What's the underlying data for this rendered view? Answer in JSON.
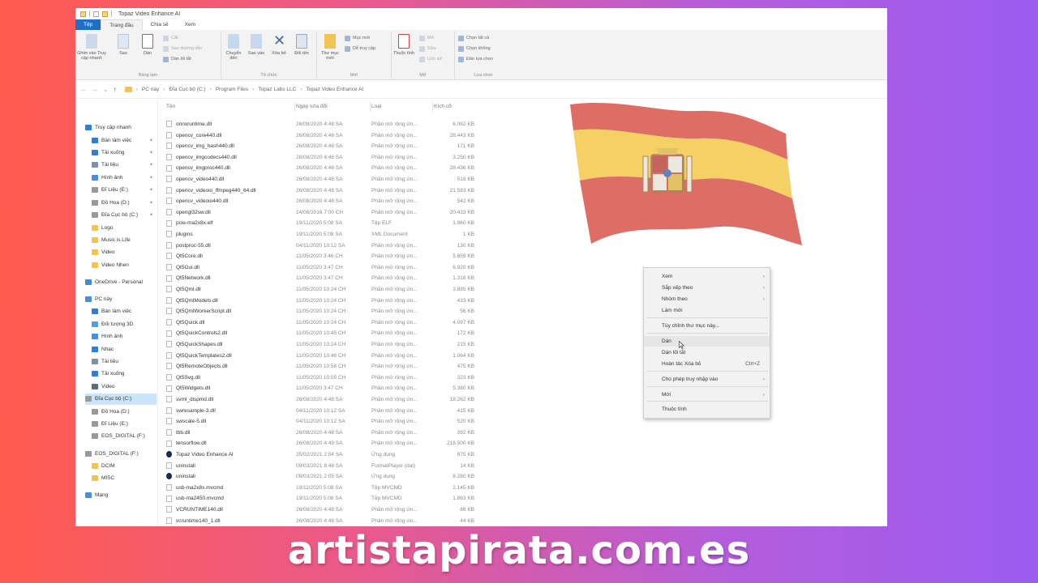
{
  "window": {
    "title": "Topaz Video Enhance AI",
    "tabs": [
      "Tệp",
      "Trang đầu",
      "Chia sẻ",
      "Xem"
    ]
  },
  "ribbon": {
    "clipboard": {
      "pin": "Ghim vào Truy cập nhanh",
      "copy": "Sao",
      "paste": "Dán",
      "cut": "Cắt",
      "copy_path": "Sao đường dẫn",
      "paste_shortcut": "Dán lối tắt",
      "label": "Bảng tạm"
    },
    "organize": {
      "move": "Chuyển đến",
      "copy_to": "Sao vào",
      "delete": "Xóa bỏ",
      "rename": "Đổi tên",
      "label": "Tổ chức"
    },
    "new": {
      "new_folder": "Thư mục mới",
      "new_item": "Mục mới",
      "easy_access": "Dễ truy cập",
      "label": "Mới"
    },
    "open": {
      "properties": "Thuộc tính",
      "open": "Mở",
      "edit": "Sửa",
      "history": "Lịch sử",
      "label": "Mở"
    },
    "select": {
      "select_all": "Chọn tất cả",
      "select_none": "Chọn không",
      "invert": "Đảo lựa chọn",
      "label": "Lựa chọn"
    }
  },
  "address": {
    "crumbs": [
      "PC này",
      "Đĩa Cục bộ (C:)",
      "Program Files",
      "Topaz Labs LLC",
      "Topaz Video Enhance AI"
    ]
  },
  "sidebar": {
    "items": [
      {
        "label": "Truy cập nhanh",
        "icon": "star-icon",
        "color": "#2f7fd6",
        "pinned": false
      },
      {
        "label": "Bàn làm việc",
        "icon": "desktop-icon",
        "color": "#2f7fd6",
        "pinned": true
      },
      {
        "label": "Tải xuống",
        "icon": "download-icon",
        "color": "#2f7fd6",
        "pinned": true
      },
      {
        "label": "Tài liệu",
        "icon": "document-icon",
        "color": "#7f8fa6",
        "pinned": true
      },
      {
        "label": "Hình ảnh",
        "icon": "image-icon",
        "color": "#4a90d9",
        "pinned": true
      },
      {
        "label": "Đĩ Liệu (E:)",
        "icon": "drive-icon",
        "color": "#999999",
        "pinned": true
      },
      {
        "label": "Đồ Hoa (D:)",
        "icon": "drive-icon",
        "color": "#999999",
        "pinned": true
      },
      {
        "label": "Đĩa Cục bộ (C:)",
        "icon": "drive-icon",
        "color": "#999999",
        "pinned": true
      },
      {
        "label": "Logo",
        "icon": "folder-icon",
        "color": "#f1c453",
        "pinned": false
      },
      {
        "label": "Music is Life",
        "icon": "folder-icon",
        "color": "#f1c453",
        "pinned": false
      },
      {
        "label": "Video",
        "icon": "folder-icon",
        "color": "#f1c453",
        "pinned": false
      },
      {
        "label": "Video Nhen",
        "icon": "folder-icon",
        "color": "#f1c453",
        "pinned": false
      },
      {
        "label": "OneDrive - Personal",
        "icon": "cloud-icon",
        "color": "#3b8ddf",
        "pinned": false
      },
      {
        "label": "PC này",
        "icon": "computer-icon",
        "color": "#4a90d9",
        "pinned": false
      },
      {
        "label": "Bàn làm việc",
        "icon": "desktop-icon",
        "color": "#2f7fd6",
        "pinned": false
      },
      {
        "label": "Đối tượng 3D",
        "icon": "cube-icon",
        "color": "#4aa3df",
        "pinned": false
      },
      {
        "label": "Hình ảnh",
        "icon": "image-icon",
        "color": "#4a90d9",
        "pinned": false
      },
      {
        "label": "Nhạc",
        "icon": "music-icon",
        "color": "#2f7fd6",
        "pinned": false
      },
      {
        "label": "Tài liệu",
        "icon": "document-icon",
        "color": "#7f8fa6",
        "pinned": false
      },
      {
        "label": "Tải xuống",
        "icon": "download-icon",
        "color": "#2f7fd6",
        "pinned": false
      },
      {
        "label": "Video",
        "icon": "video-icon",
        "color": "#5b6b80",
        "pinned": false
      },
      {
        "label": "Đĩa Cục bộ (C:)",
        "icon": "drive-icon",
        "color": "#999999",
        "pinned": false
      },
      {
        "label": "Đồ Hoa (D:)",
        "icon": "drive-icon",
        "color": "#999999",
        "pinned": false
      },
      {
        "label": "Đĩ Liệu (E:)",
        "icon": "drive-icon",
        "color": "#999999",
        "pinned": false
      },
      {
        "label": "EOS_DIGITAL (F:)",
        "icon": "drive-icon",
        "color": "#999999",
        "pinned": false
      },
      {
        "label": "EOS_DIGITAL (F:)",
        "icon": "drive-icon",
        "color": "#999999",
        "pinned": false
      },
      {
        "label": "DCIM",
        "icon": "folder-icon",
        "color": "#f1c453",
        "pinned": false
      },
      {
        "label": "MISC",
        "icon": "folder-icon",
        "color": "#f1c453",
        "pinned": false
      },
      {
        "label": "Mạng",
        "icon": "network-icon",
        "color": "#4a90d9",
        "pinned": false
      }
    ]
  },
  "list": {
    "headers": {
      "name": "Tên",
      "date": "Ngày sửa đổi",
      "type": "Loại",
      "size": "Kích cỡ"
    },
    "rows": [
      {
        "name": "onnxruntime.dll",
        "date": "26/08/2020 4:48 SA",
        "type": "Phần mở rộng ứn...",
        "size": "6.062 KB",
        "icon": "file"
      },
      {
        "name": "opencv_core440.dll",
        "date": "26/08/2020 4:48 SA",
        "type": "Phần mở rộng ứn...",
        "size": "28.443 KB",
        "icon": "file"
      },
      {
        "name": "opencv_img_hash440.dll",
        "date": "26/08/2020 4:48 SA",
        "type": "Phần mở rộng ứn...",
        "size": "171 KB",
        "icon": "file"
      },
      {
        "name": "opencv_imgcodecs440.dll",
        "date": "26/08/2020 4:48 SA",
        "type": "Phần mở rộng ứn...",
        "size": "3.250 KB",
        "icon": "file"
      },
      {
        "name": "opencv_imgproc440.dll",
        "date": "26/08/2020 4:48 SA",
        "type": "Phần mở rộng ứn...",
        "size": "28.436 KB",
        "icon": "file"
      },
      {
        "name": "opencv_video440.dll",
        "date": "26/08/2020 4:48 SA",
        "type": "Phần mở rộng ứn...",
        "size": "519 KB",
        "icon": "file"
      },
      {
        "name": "opencv_videoio_ffmpeg440_64.dll",
        "date": "26/08/2020 4:48 SA",
        "type": "Phần mở rộng ứn...",
        "size": "21.583 KB",
        "icon": "file"
      },
      {
        "name": "opencv_videoio440.dll",
        "date": "26/08/2020 4:48 SA",
        "type": "Phần mở rộng ứn...",
        "size": "542 KB",
        "icon": "file"
      },
      {
        "name": "opengl32sw.dll",
        "date": "14/06/2016 7:00 CH",
        "type": "Phần mở rộng ứn...",
        "size": "20.433 KB",
        "icon": "file"
      },
      {
        "name": "pcie-ma2x8x.elf",
        "date": "19/11/2020 5:08 SA",
        "type": "Tệp ELF",
        "size": "1.960 KB",
        "icon": "file"
      },
      {
        "name": "plugins",
        "date": "19/11/2020 5:08 SA",
        "type": "XML Document",
        "size": "1 KB",
        "icon": "file"
      },
      {
        "name": "postproc-55.dll",
        "date": "04/11/2020 10:12 SA",
        "type": "Phần mở rộng ứn...",
        "size": "130 KB",
        "icon": "file"
      },
      {
        "name": "Qt5Core.dll",
        "date": "11/05/2020 3:46 CH",
        "type": "Phần mở rộng ứn...",
        "size": "5.859 KB",
        "icon": "file"
      },
      {
        "name": "Qt5Gui.dll",
        "date": "11/05/2020 3:47 CH",
        "type": "Phần mở rộng ứn...",
        "size": "6.920 KB",
        "icon": "file"
      },
      {
        "name": "Qt5Network.dll",
        "date": "11/05/2020 3:47 CH",
        "type": "Phần mở rộng ứn...",
        "size": "1.318 KB",
        "icon": "file"
      },
      {
        "name": "Qt5Qml.dll",
        "date": "11/05/2020 10:24 CH",
        "type": "Phần mở rộng ứn...",
        "size": "3.885 KB",
        "icon": "file"
      },
      {
        "name": "Qt5QmlModels.dll",
        "date": "11/05/2020 10:24 CH",
        "type": "Phần mở rộng ứn...",
        "size": "433 KB",
        "icon": "file"
      },
      {
        "name": "Qt5QmlWorkerScript.dll",
        "date": "11/05/2020 10:24 CH",
        "type": "Phần mở rộng ứn...",
        "size": "56 KB",
        "icon": "file"
      },
      {
        "name": "Qt5Quick.dll",
        "date": "11/05/2020 10:24 CH",
        "type": "Phần mở rộng ứn...",
        "size": "4.097 KB",
        "icon": "file"
      },
      {
        "name": "Qt5QuickControls2.dll",
        "date": "11/05/2020 10:45 CH",
        "type": "Phần mở rộng ứn...",
        "size": "172 KB",
        "icon": "file"
      },
      {
        "name": "Qt5QuickShapes.dll",
        "date": "11/05/2020 10:24 CH",
        "type": "Phần mở rộng ứn...",
        "size": "215 KB",
        "icon": "file"
      },
      {
        "name": "Qt5QuickTemplates2.dll",
        "date": "11/05/2020 10:46 CH",
        "type": "Phần mở rộng ứn...",
        "size": "1.064 KB",
        "icon": "file"
      },
      {
        "name": "Qt5RemoteObjects.dll",
        "date": "11/05/2020 10:58 CH",
        "type": "Phần mở rộng ứn...",
        "size": "475 KB",
        "icon": "file"
      },
      {
        "name": "Qt5Svg.dll",
        "date": "11/05/2020 10:05 CH",
        "type": "Phần mở rộng ứn...",
        "size": "323 KB",
        "icon": "file"
      },
      {
        "name": "Qt5Widgets.dll",
        "date": "11/05/2020 3:47 CH",
        "type": "Phần mở rộng ứn...",
        "size": "5.380 KB",
        "icon": "file"
      },
      {
        "name": "svml_dispmd.dll",
        "date": "26/08/2020 4:48 SA",
        "type": "Phần mở rộng ứn...",
        "size": "18.262 KB",
        "icon": "file"
      },
      {
        "name": "swresample-3.dll",
        "date": "04/11/2020 10:12 SA",
        "type": "Phần mở rộng ứn...",
        "size": "415 KB",
        "icon": "file"
      },
      {
        "name": "swscale-5.dll",
        "date": "04/11/2020 10:12 SA",
        "type": "Phần mở rộng ứn...",
        "size": "520 KB",
        "icon": "file"
      },
      {
        "name": "tbb.dll",
        "date": "26/08/2020 4:48 SA",
        "type": "Phần mở rộng ứn...",
        "size": "392 KB",
        "icon": "file"
      },
      {
        "name": "tensorflow.dll",
        "date": "26/08/2020 4:49 SA",
        "type": "Phần mở rộng ứn...",
        "size": "218.500 KB",
        "icon": "file"
      },
      {
        "name": "Topaz Video Enhance AI",
        "date": "25/02/2021 2:04 SA",
        "type": "Ứng dụng",
        "size": "975 KB",
        "icon": "app"
      },
      {
        "name": "uninstall",
        "date": "09/03/2021 8:48 SA",
        "type": "FormatPlayer (dat)",
        "size": "14 KB",
        "icon": "file"
      },
      {
        "name": "uninstall",
        "date": "09/03/2021 2:05 SA",
        "type": "Ứng dụng",
        "size": "8.280 KB",
        "icon": "app"
      },
      {
        "name": "usb-ma2x8x.mvcmd",
        "date": "19/11/2020 5:08 SA",
        "type": "Tệp MVCMD",
        "size": "2.145 KB",
        "icon": "file"
      },
      {
        "name": "usb-ma2450.mvcmd",
        "date": "19/11/2020 5:08 SA",
        "type": "Tệp MVCMD",
        "size": "1.863 KB",
        "icon": "file"
      },
      {
        "name": "VCRUNTIME140.dll",
        "date": "26/08/2020 4:48 SA",
        "type": "Phần mở rộng ứn...",
        "size": "86 KB",
        "icon": "file"
      },
      {
        "name": "vcruntime140_1.dll",
        "date": "26/08/2020 4:48 SA",
        "type": "Phần mở rộng ứn...",
        "size": "44 KB",
        "icon": "file"
      },
      {
        "name": "veai",
        "date": "25/02/2021 2:05 SA",
        "type": "Ứng dụng",
        "size": "974 KB",
        "icon": "app"
      }
    ]
  },
  "context_menu": {
    "items": [
      {
        "label": "Xem",
        "arrow": "›",
        "shortcut": ""
      },
      {
        "label": "Sắp xếp theo",
        "arrow": "›",
        "shortcut": ""
      },
      {
        "label": "Nhóm theo",
        "arrow": "›",
        "shortcut": ""
      },
      {
        "label": "Làm mới",
        "arrow": "",
        "shortcut": ""
      },
      {
        "label": "Tùy chỉnh thư mục này...",
        "arrow": "",
        "shortcut": ""
      },
      {
        "label": "Dán",
        "arrow": "",
        "shortcut": ""
      },
      {
        "label": "Dán lối tắt",
        "arrow": "",
        "shortcut": ""
      },
      {
        "label": "Hoàn tác Xóa bỏ",
        "arrow": "",
        "shortcut": "Ctrl+Z"
      },
      {
        "label": "Cho phép truy nhập vào",
        "arrow": "›",
        "shortcut": ""
      },
      {
        "label": "Mới",
        "arrow": "›",
        "shortcut": ""
      },
      {
        "label": "Thuộc tính",
        "arrow": "",
        "shortcut": ""
      }
    ]
  },
  "flag": {
    "red": "#d6453a",
    "yellow": "#f1c43a"
  },
  "caption": "artistapirata.com.es"
}
